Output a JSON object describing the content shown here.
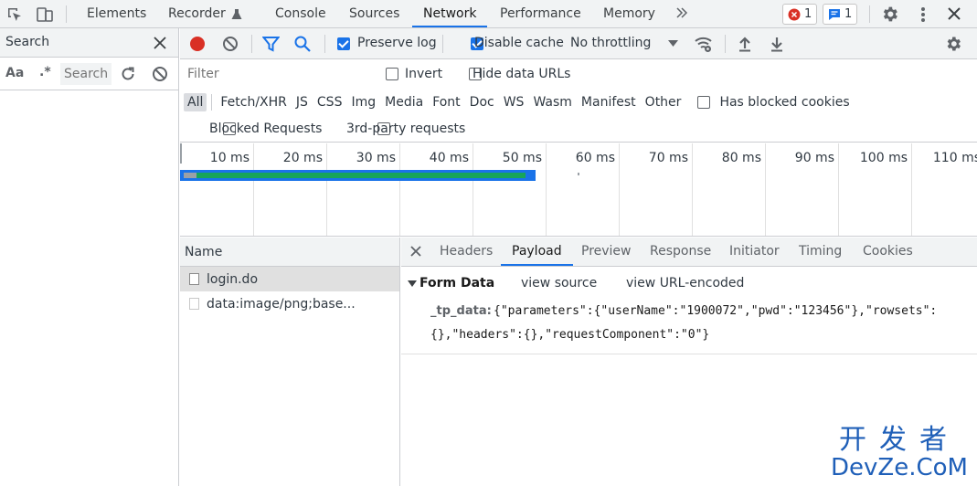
{
  "top_tabs": [
    {
      "label": "Elements"
    },
    {
      "label": "Recorder"
    },
    {
      "label": "Console"
    },
    {
      "label": "Sources"
    },
    {
      "label": "Network"
    },
    {
      "label": "Performance"
    },
    {
      "label": "Memory"
    }
  ],
  "active_top_tab": "Network",
  "more_tabs_icon": "chevron-double-right-icon",
  "badges": {
    "errors": "1",
    "messages": "1"
  },
  "colors": {
    "accent": "#1a73e8",
    "record": "#d93025",
    "error": "#d93025",
    "timeline_bar": "#1a73e8",
    "timeline_bar_inner": "#17a55a"
  },
  "search_pane": {
    "title": "Search",
    "case_label": "Aa",
    "regex_label": ".*",
    "input_placeholder": "Search"
  },
  "network_toolbar": {
    "preserve_log": {
      "label": "Preserve log",
      "checked": true
    },
    "disable_cache": {
      "label": "Disable cache",
      "checked": true
    },
    "throttling": "No throttling"
  },
  "filter": {
    "placeholder": "Filter",
    "invert": {
      "label": "Invert",
      "checked": false
    },
    "hide_data_urls": {
      "label": "Hide data URLs",
      "checked": false
    },
    "types": [
      "All",
      "Fetch/XHR",
      "JS",
      "CSS",
      "Img",
      "Media",
      "Font",
      "Doc",
      "WS",
      "Wasm",
      "Manifest",
      "Other"
    ],
    "active_type": "All",
    "has_blocked_cookies": {
      "label": "Has blocked cookies",
      "checked": false
    },
    "blocked_requests": {
      "label": "Blocked Requests",
      "checked": false
    },
    "third_party": {
      "label": "3rd-party requests",
      "checked": false
    }
  },
  "timeline": {
    "ticks": [
      "10 ms",
      "20 ms",
      "30 ms",
      "40 ms",
      "50 ms",
      "60 ms",
      "70 ms",
      "80 ms",
      "90 ms",
      "100 ms",
      "110 ms"
    ]
  },
  "requests": {
    "header": "Name",
    "rows": [
      {
        "name": "login.do",
        "selected": true
      },
      {
        "name": "data:image/png;base...",
        "selected": false
      }
    ]
  },
  "detail": {
    "tabs": [
      "Headers",
      "Payload",
      "Preview",
      "Response",
      "Initiator",
      "Timing",
      "Cookies"
    ],
    "active_tab": "Payload",
    "form_data": {
      "title": "Form Data",
      "view_source": "view source",
      "view_url_encoded": "view URL-encoded",
      "key": "_tp_data:",
      "value_line1": "{\"parameters\":{\"userName\":\"1900072\",\"pwd\":\"123456\"},\"rowsets\":",
      "value_line2": "{},\"headers\":{},\"requestComponent\":\"0\"}"
    }
  },
  "watermark": {
    "chinese": "开发者",
    "latin": "DevZe.CoM"
  }
}
